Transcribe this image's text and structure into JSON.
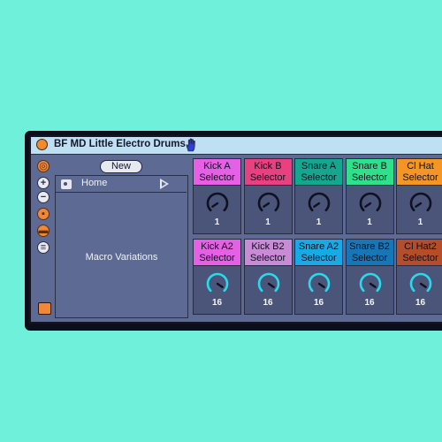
{
  "colors": {
    "background": "#6ef0db",
    "device_body": "#5d6a93",
    "titlebar": "#bfe0f3",
    "accent_orange": "#f0883a"
  },
  "device": {
    "title": "BF MD Little Electro Drums",
    "title_icon": "hand-icon",
    "new_label": "New",
    "home_label": "Home",
    "variations_label": "Macro Variations"
  },
  "macros_row1": [
    {
      "l1": "Kick A",
      "l2": "Selector",
      "value": "1",
      "color": "#e660e6",
      "knob": "dark"
    },
    {
      "l1": "Kick B",
      "l2": "Selector",
      "value": "1",
      "color": "#e8417f",
      "knob": "dark"
    },
    {
      "l1": "Snare A",
      "l2": "Selector",
      "value": "1",
      "color": "#14a68f",
      "knob": "dark"
    },
    {
      "l1": "Snare B",
      "l2": "Selector",
      "value": "1",
      "color": "#2ee08a",
      "knob": "dark"
    },
    {
      "l1": "Cl Hat",
      "l2": "Selector",
      "value": "1",
      "color": "#f49625",
      "knob": "dark"
    }
  ],
  "macros_row2": [
    {
      "l1": "Kick A2",
      "l2": "Selector",
      "value": "16",
      "color": "#e660e6",
      "knob": "cyan"
    },
    {
      "l1": "Kick B2",
      "l2": "Selector",
      "value": "16",
      "color": "#c98ad6",
      "knob": "cyan"
    },
    {
      "l1": "Snare A2",
      "l2": "Selector",
      "value": "16",
      "color": "#18a9e6",
      "knob": "cyan"
    },
    {
      "l1": "Snare B2",
      "l2": "Selector",
      "value": "16",
      "color": "#1677b8",
      "knob": "cyan"
    },
    {
      "l1": "Cl Hat2",
      "l2": "Selector",
      "value": "16",
      "color": "#b34d2a",
      "knob": "cyan"
    }
  ]
}
